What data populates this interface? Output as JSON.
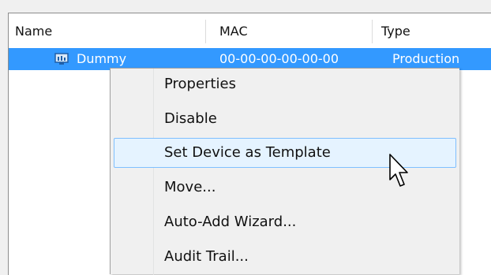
{
  "list": {
    "columns": [
      "Name",
      "MAC",
      "Type"
    ],
    "rows": [
      {
        "icon": "network-device-icon",
        "name": "Dummy",
        "mac": "00-00-00-00-00-00",
        "type": "Production"
      }
    ]
  },
  "context_menu": {
    "items": [
      {
        "label": "Properties",
        "highlighted": false
      },
      {
        "label": "Disable",
        "highlighted": false
      },
      {
        "label": "Set Device as Template",
        "highlighted": true
      },
      {
        "label": "Move...",
        "highlighted": false
      },
      {
        "label": "Auto-Add Wizard...",
        "highlighted": false
      },
      {
        "label": "Audit Trail...",
        "highlighted": false
      }
    ]
  },
  "colors": {
    "selection": "#3399ff",
    "menu_highlight": "#e5f3ff",
    "menu_highlight_border": "#7fbfff"
  }
}
